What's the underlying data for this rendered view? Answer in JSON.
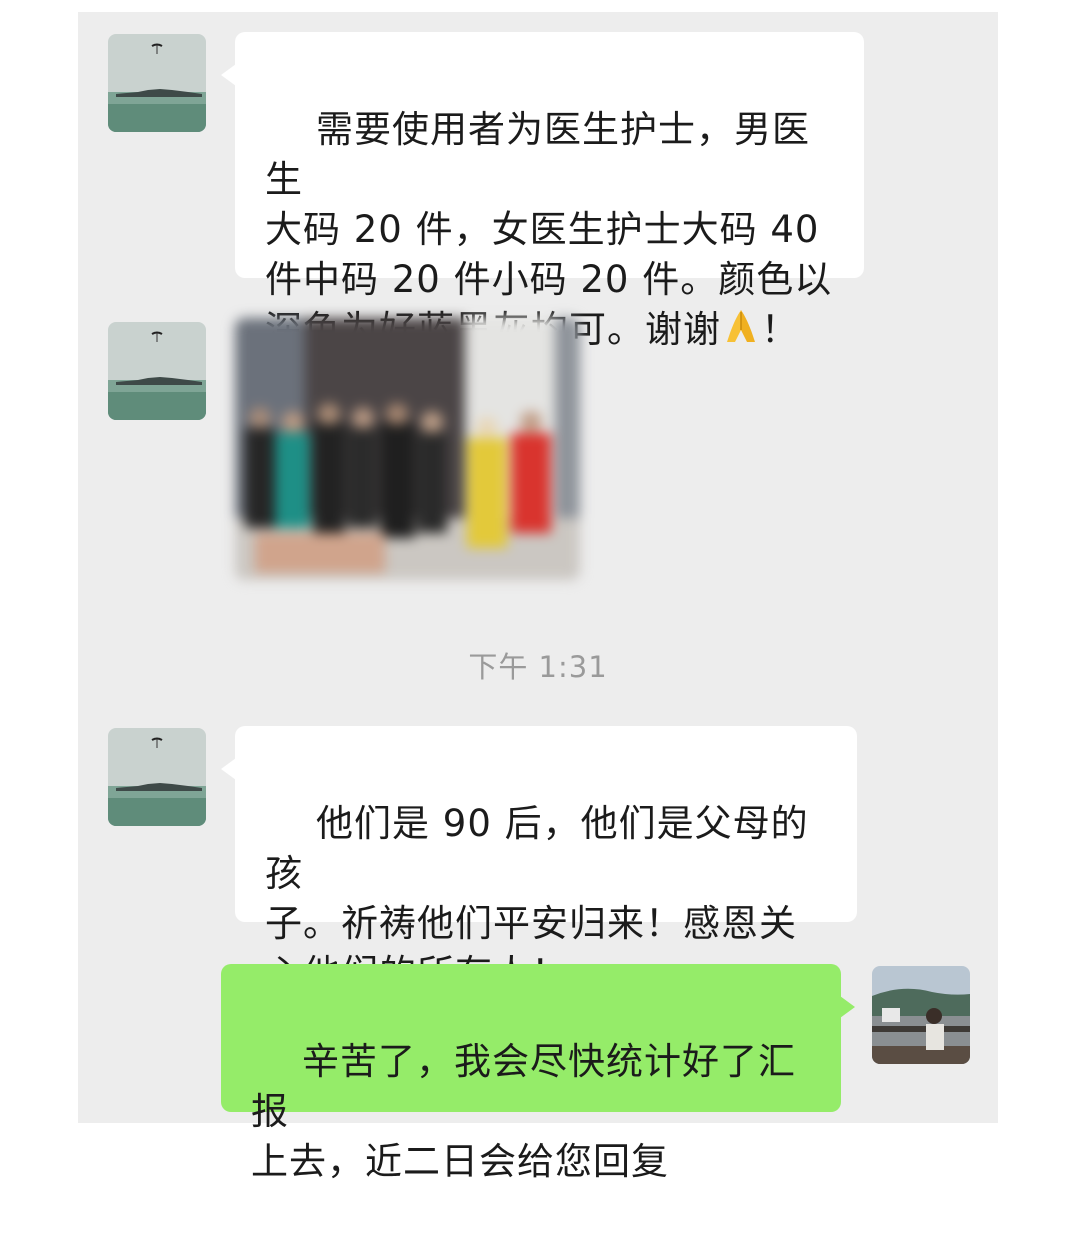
{
  "messages": [
    {
      "sender": "other",
      "avatar": "seaside-paraglider-avatar",
      "type": "text",
      "text": "需要使用者为医生护士，男医生\n大码 20 件，女医生护士大码 40\n件中码 20 件小码 20 件。颜色以\n深色为好蓝黑灰均可。谢谢",
      "emoji": "🙏",
      "tail": "！"
    },
    {
      "sender": "other",
      "avatar": "seaside-paraglider-avatar",
      "type": "image",
      "image": "blurred-group-photo"
    },
    {
      "sender": "other",
      "avatar": "seaside-paraglider-avatar",
      "type": "text",
      "text": "他们是 90 后，他们是父母的孩\n子。祈祷他们平安归来！感恩关\n心他们的所有人！"
    },
    {
      "sender": "self",
      "avatar": "balcony-person-avatar",
      "type": "text",
      "text": "辛苦了，我会尽快统计好了汇报\n上去，近二日会给您回复"
    }
  ],
  "timestamp": "下午 1:31",
  "colors": {
    "chat_background": "#ededed",
    "incoming_bubble": "#ffffff",
    "outgoing_bubble": "#95ec69",
    "timestamp_text": "#9a9a9a"
  }
}
